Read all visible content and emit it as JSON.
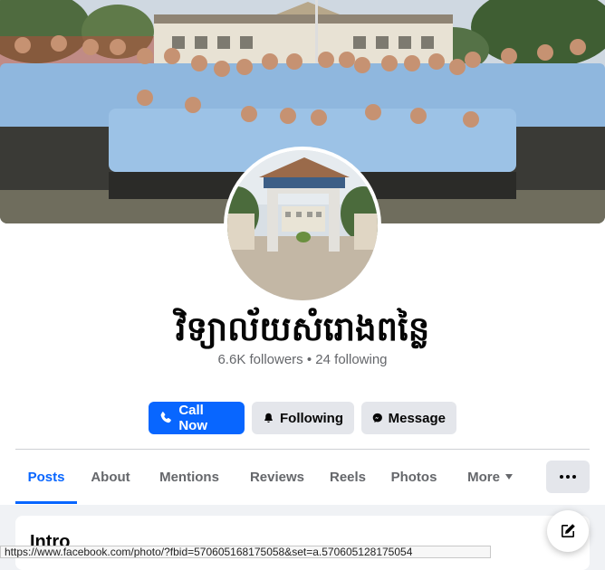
{
  "page": {
    "name": "វិទ្យាល័យសំរោងពន្លៃ",
    "followers_text": "6.6K followers",
    "separator": "•",
    "following_text": "24 following"
  },
  "actions": {
    "call_label": "Call Now",
    "following_label": "Following",
    "message_label": "Message"
  },
  "tabs": [
    {
      "label": "Posts",
      "active": true
    },
    {
      "label": "About"
    },
    {
      "label": "Mentions"
    },
    {
      "label": "Reviews"
    },
    {
      "label": "Reels"
    },
    {
      "label": "Photos"
    },
    {
      "label": "More"
    }
  ],
  "intro": {
    "title": "Intro"
  },
  "status_bar": {
    "url": "https://www.facebook.com/photo/?fbid=570605168175058&set=a.570605128175054"
  },
  "icons": {
    "call": "phone-icon",
    "following": "bell-icon",
    "message": "messenger-icon",
    "more": "caret-down-icon",
    "options": "more-dots-icon",
    "compose": "compose-icon"
  },
  "colors": {
    "accent": "#0866ff",
    "secondary_button": "#e4e6eb",
    "muted_text": "#65676b"
  }
}
